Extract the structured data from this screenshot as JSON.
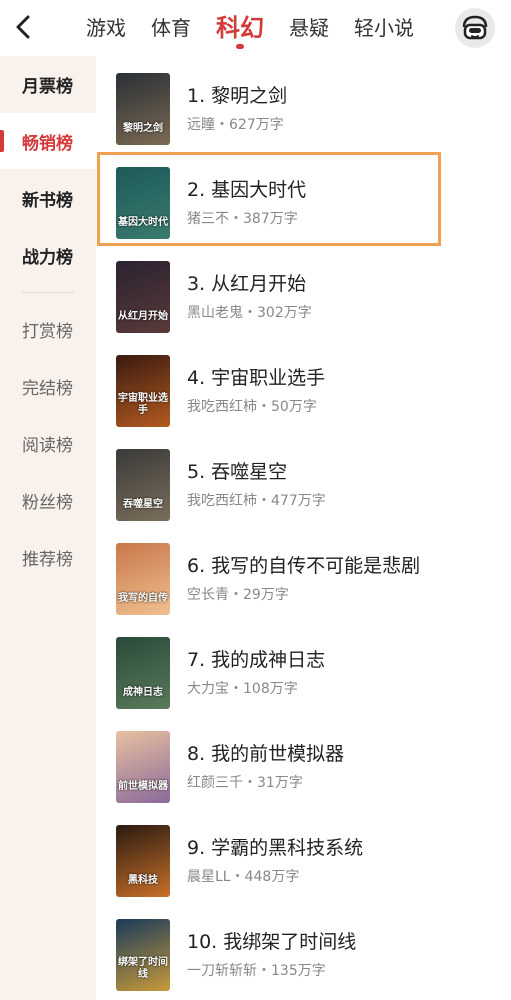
{
  "header": {
    "tabs": [
      {
        "label": "游戏",
        "active": false
      },
      {
        "label": "体育",
        "active": false
      },
      {
        "label": "科幻",
        "active": true
      },
      {
        "label": "悬疑",
        "active": false
      },
      {
        "label": "轻小说",
        "active": false
      }
    ]
  },
  "sidebar": {
    "items": [
      {
        "label": "月票榜",
        "selected": false
      },
      {
        "label": "畅销榜",
        "selected": true
      },
      {
        "label": "新书榜",
        "selected": false
      },
      {
        "label": "战力榜",
        "selected": false
      },
      {
        "label": "打赏榜",
        "selected": false
      },
      {
        "label": "完结榜",
        "selected": false
      },
      {
        "label": "阅读榜",
        "selected": false
      },
      {
        "label": "粉丝榜",
        "selected": false
      },
      {
        "label": "推荐榜",
        "selected": false
      }
    ]
  },
  "books": [
    {
      "title": "1. 黎明之剑",
      "meta": "远瞳・627万字",
      "cover_text": "黎明之剑",
      "cover_colors": [
        "#2a2f36",
        "#7a6a52"
      ]
    },
    {
      "title": "2. 基因大时代",
      "meta": "猪三不・387万字",
      "cover_text": "基因大时代",
      "cover_colors": [
        "#1d5a5a",
        "#3b7a6e"
      ]
    },
    {
      "title": "3. 从红月开始",
      "meta": "黑山老鬼・302万字",
      "cover_text": "从红月开始",
      "cover_colors": [
        "#2a2230",
        "#5a3a3a"
      ]
    },
    {
      "title": "4. 宇宙职业选手",
      "meta": "我吃西红柿・50万字",
      "cover_text": "宇宙职业选手",
      "cover_colors": [
        "#3a1a10",
        "#b35a20"
      ]
    },
    {
      "title": "5. 吞噬星空",
      "meta": "我吃西红柿・477万字",
      "cover_text": "吞噬星空",
      "cover_colors": [
        "#3a3a3a",
        "#7a6e5a"
      ]
    },
    {
      "title": "6. 我写的自传不可能是悲剧",
      "meta": "空长青・29万字",
      "cover_text": "我写的自传",
      "cover_colors": [
        "#c8774a",
        "#f0c090"
      ]
    },
    {
      "title": "7. 我的成神日志",
      "meta": "大力宝・108万字",
      "cover_text": "成神日志",
      "cover_colors": [
        "#2a4a3a",
        "#5a7a5a"
      ]
    },
    {
      "title": "8. 我的前世模拟器",
      "meta": "红颜三千・31万字",
      "cover_text": "前世模拟器",
      "cover_colors": [
        "#e8c0a0",
        "#8a6a9a"
      ]
    },
    {
      "title": "9. 学霸的黑科技系统",
      "meta": "晨星LL・448万字",
      "cover_text": "黑科技",
      "cover_colors": [
        "#2a1a10",
        "#c8702a"
      ]
    },
    {
      "title": "10. 我绑架了时间线",
      "meta": "一刀斩斩斩・135万字",
      "cover_text": "绑架了时间线",
      "cover_colors": [
        "#1a3a5a",
        "#c89a3a"
      ]
    }
  ],
  "colors": {
    "accent": "#d33a3a",
    "sidebar_bg": "#f8f1ec",
    "highlight": "#f0a050"
  },
  "icons": {
    "back": "chevron-left-icon",
    "avatar": "robot-face-icon"
  }
}
